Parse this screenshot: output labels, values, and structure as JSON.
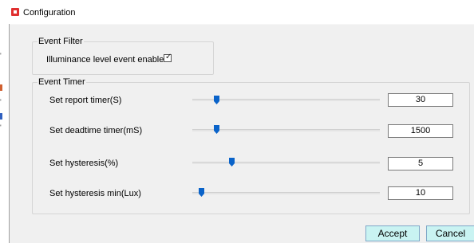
{
  "window": {
    "title": "Configuration"
  },
  "event_filter": {
    "legend": "Event Filter",
    "illuminance_label": "Illuminance level event enabled",
    "illuminance_checked": true
  },
  "event_timer": {
    "legend": "Event Timer",
    "rows": [
      {
        "label": "Set report timer(S)",
        "value": "30",
        "slider_fraction": 0.13
      },
      {
        "label": "Set deadtime timer(mS)",
        "value": "1500",
        "slider_fraction": 0.13
      },
      {
        "label": "Set hysteresis(%)",
        "value": "5",
        "slider_fraction": 0.21
      },
      {
        "label": "Set hysteresis min(Lux)",
        "value": "10",
        "slider_fraction": 0.05
      }
    ]
  },
  "buttons": {
    "accept": "Accept",
    "cancel": "Cancel"
  },
  "colors": {
    "accent": "#0a63c9",
    "button_bg": "#c9f3f2",
    "app_icon": "#e03030"
  }
}
